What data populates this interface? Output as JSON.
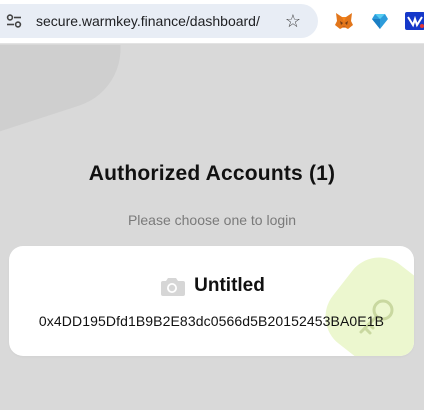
{
  "browser": {
    "url": "secure.warmkey.finance/dashboard/",
    "icons": {
      "site_info": "tune-icon",
      "bookmark": "star-icon",
      "extensions": [
        "metamask-fox-icon",
        "blue-gem-icon",
        "blue-extension-icon"
      ]
    }
  },
  "page": {
    "heading": "Authorized Accounts (1)",
    "subheading": "Please choose one to login",
    "accounts": [
      {
        "name": "Untitled",
        "address": "0x4DD195Dfd1B9B2E83dc0566d5B20152453BA0E1B",
        "icons": [
          "camera-icon",
          "key-icon"
        ]
      }
    ]
  },
  "colors": {
    "page_background": "#d9d9d9",
    "card_background": "#ffffff",
    "key_accent": "#ecf7cf",
    "omnibox": "#e8edf5"
  }
}
